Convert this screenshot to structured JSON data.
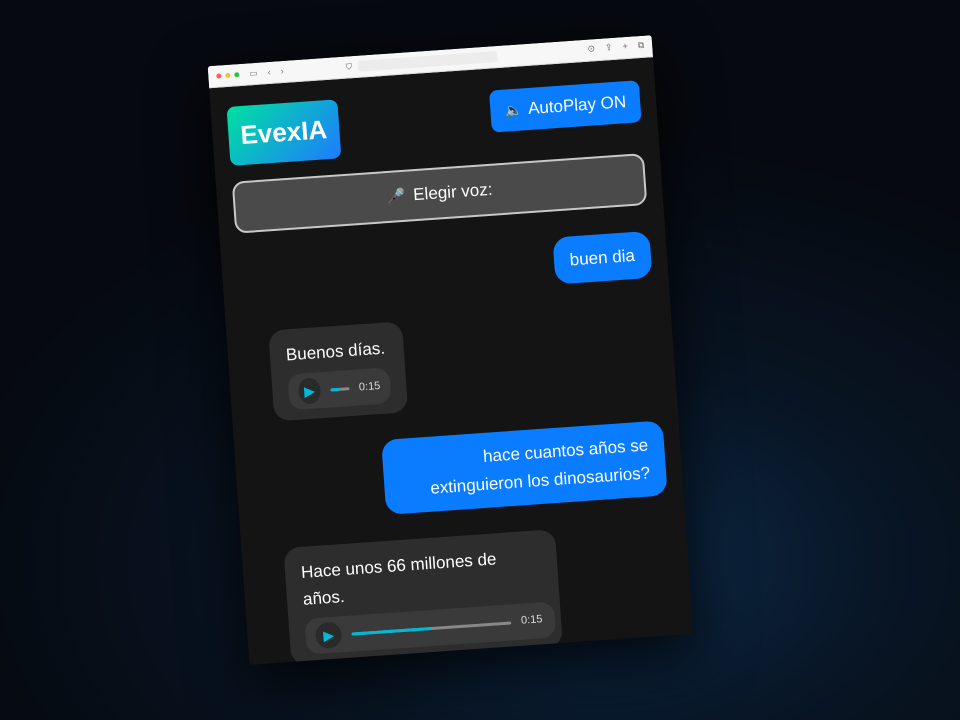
{
  "app": {
    "logo": "EvexIA",
    "autoplay_label": "AutoPlay ON",
    "voice_label": "Elegir voz:"
  },
  "messages": [
    {
      "role": "user",
      "text": "buen dia"
    },
    {
      "role": "bot",
      "text": "Buenos días.",
      "audio_time": "0:15",
      "progress": 0.5
    },
    {
      "role": "user",
      "text": "hace cuantos años se extinguieron los dinosaurios?"
    },
    {
      "role": "bot",
      "text": "Hace unos 66 millones de años.",
      "audio_time": "0:15",
      "progress": 0.5
    }
  ],
  "colors": {
    "accent": "#0a7cff",
    "logo_gradient_start": "#00e0a0",
    "logo_gradient_end": "#1e7bff",
    "audio_progress": "#00b8d9"
  },
  "icons": {
    "speaker": "speaker-icon",
    "microphone": "microphone-icon",
    "play": "play-icon"
  }
}
